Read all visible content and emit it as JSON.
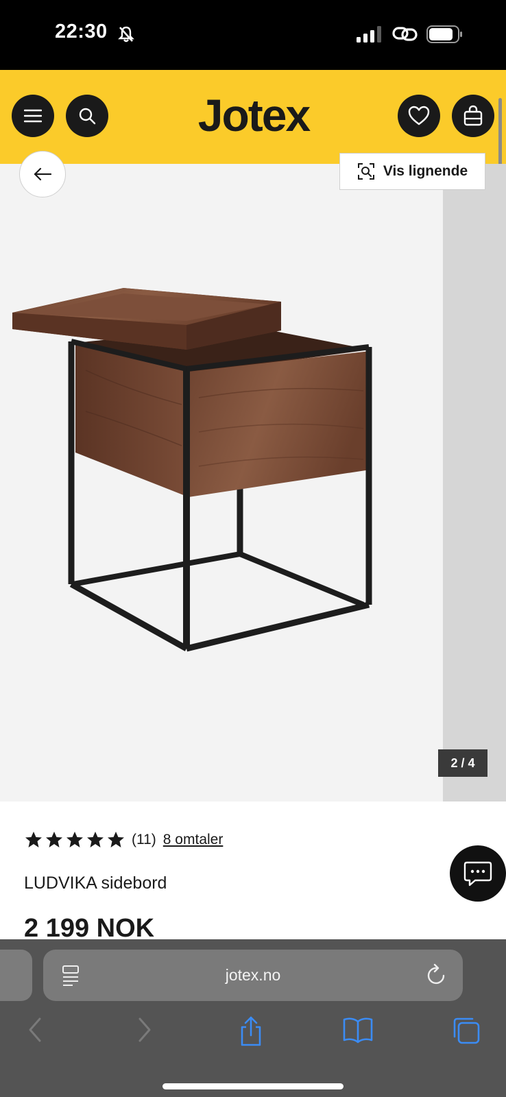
{
  "status_bar": {
    "time": "22:30"
  },
  "header": {
    "logo": "Jotex"
  },
  "gallery": {
    "similar_button_label": "Vis lignende",
    "counter": "2 / 4"
  },
  "product": {
    "rating_stars": 5,
    "rating_count": "(11)",
    "reviews_link": "8 omtaler",
    "name": "LUDVIKA sidebord",
    "price": "2 199 NOK"
  },
  "browser": {
    "url": "jotex.no"
  },
  "colors": {
    "brand_yellow": "#fbcb2a",
    "dark": "#1a1a1a",
    "browser_bar": "#545454"
  }
}
